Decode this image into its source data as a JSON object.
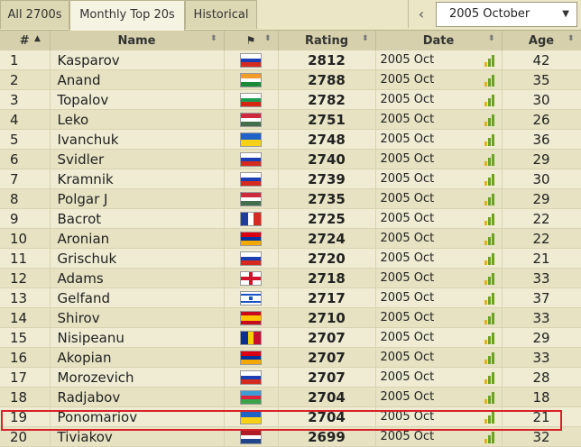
{
  "tabs": [
    {
      "label": "All 2700s",
      "active": false
    },
    {
      "label": "Monthly Top 20s",
      "active": true
    },
    {
      "label": "Historical",
      "active": false
    }
  ],
  "month_select": {
    "value": "2005 October"
  },
  "columns": {
    "rank": "#",
    "name": "Name",
    "flag": "",
    "rating": "Rating",
    "date": "Date",
    "age": "Age"
  },
  "rows": [
    {
      "rank": "1",
      "name": "Kasparov",
      "country": "Russia",
      "rating": "2812",
      "date": "2005 Oct",
      "age": "42"
    },
    {
      "rank": "2",
      "name": "Anand",
      "country": "India",
      "rating": "2788",
      "date": "2005 Oct",
      "age": "35"
    },
    {
      "rank": "3",
      "name": "Topalov",
      "country": "Bulgaria",
      "rating": "2782",
      "date": "2005 Oct",
      "age": "30"
    },
    {
      "rank": "4",
      "name": "Leko",
      "country": "Hungary",
      "rating": "2751",
      "date": "2005 Oct",
      "age": "26"
    },
    {
      "rank": "5",
      "name": "Ivanchuk",
      "country": "Ukraine",
      "rating": "2748",
      "date": "2005 Oct",
      "age": "36"
    },
    {
      "rank": "6",
      "name": "Svidler",
      "country": "Russia",
      "rating": "2740",
      "date": "2005 Oct",
      "age": "29"
    },
    {
      "rank": "7",
      "name": "Kramnik",
      "country": "Russia",
      "rating": "2739",
      "date": "2005 Oct",
      "age": "30"
    },
    {
      "rank": "8",
      "name": "Polgar J",
      "country": "Hungary",
      "rating": "2735",
      "date": "2005 Oct",
      "age": "29"
    },
    {
      "rank": "9",
      "name": "Bacrot",
      "country": "France",
      "rating": "2725",
      "date": "2005 Oct",
      "age": "22"
    },
    {
      "rank": "10",
      "name": "Aronian",
      "country": "Armenia",
      "rating": "2724",
      "date": "2005 Oct",
      "age": "22"
    },
    {
      "rank": "11",
      "name": "Grischuk",
      "country": "Russia",
      "rating": "2720",
      "date": "2005 Oct",
      "age": "21"
    },
    {
      "rank": "12",
      "name": "Adams",
      "country": "England",
      "rating": "2718",
      "date": "2005 Oct",
      "age": "33"
    },
    {
      "rank": "13",
      "name": "Gelfand",
      "country": "Israel",
      "rating": "2717",
      "date": "2005 Oct",
      "age": "37"
    },
    {
      "rank": "14",
      "name": "Shirov",
      "country": "Spain",
      "rating": "2710",
      "date": "2005 Oct",
      "age": "33"
    },
    {
      "rank": "15",
      "name": "Nisipeanu",
      "country": "Romania",
      "rating": "2707",
      "date": "2005 Oct",
      "age": "29"
    },
    {
      "rank": "16",
      "name": "Akopian",
      "country": "Armenia",
      "rating": "2707",
      "date": "2005 Oct",
      "age": "33"
    },
    {
      "rank": "17",
      "name": "Morozevich",
      "country": "Russia",
      "rating": "2707",
      "date": "2005 Oct",
      "age": "28"
    },
    {
      "rank": "18",
      "name": "Radjabov",
      "country": "Azerbaijan",
      "rating": "2704",
      "date": "2005 Oct",
      "age": "18"
    },
    {
      "rank": "19",
      "name": "Ponomariov",
      "country": "Ukraine",
      "rating": "2704",
      "date": "2005 Oct",
      "age": "21"
    },
    {
      "rank": "20",
      "name": "Tiviakov",
      "country": "Netherlands",
      "rating": "2699",
      "date": "2005 Oct",
      "age": "32"
    }
  ],
  "highlighted_row": "20",
  "colors": {
    "highlight": "#d8222a",
    "bar_green": "#6aa321",
    "bar_yellow": "#e3b21b"
  }
}
